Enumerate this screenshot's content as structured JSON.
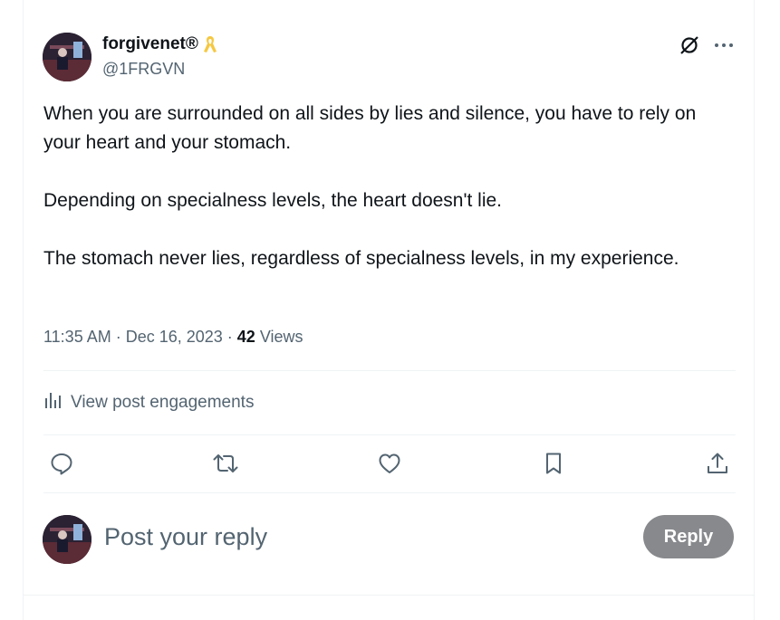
{
  "post": {
    "author": {
      "display_name": "forgivenet®",
      "handle": "@1FRGVN",
      "badge_icon": "awareness-ribbon-icon",
      "badge_color": "#f5c842"
    },
    "paragraphs": [
      "When you are surrounded on all sides by lies and silence, you have to rely on your heart and your stomach.",
      "Depending on specialness levels, the heart doesn't lie.",
      "The stomach never lies, regardless of specialness levels, in my experience."
    ],
    "time": "11:35 AM",
    "separator": " · ",
    "date": "Dec 16, 2023",
    "views_count": "42",
    "views_label": " Views"
  },
  "engagements": {
    "label": "View post engagements"
  },
  "actions": [
    "reply-icon",
    "repost-icon",
    "like-icon",
    "bookmark-icon",
    "share-icon"
  ],
  "reply_box": {
    "placeholder": "Post your reply",
    "button_label": "Reply",
    "button_color": "#87898c"
  },
  "colors": {
    "text": "#0f1419",
    "secondary": "#536471",
    "border": "#eff3f4"
  }
}
